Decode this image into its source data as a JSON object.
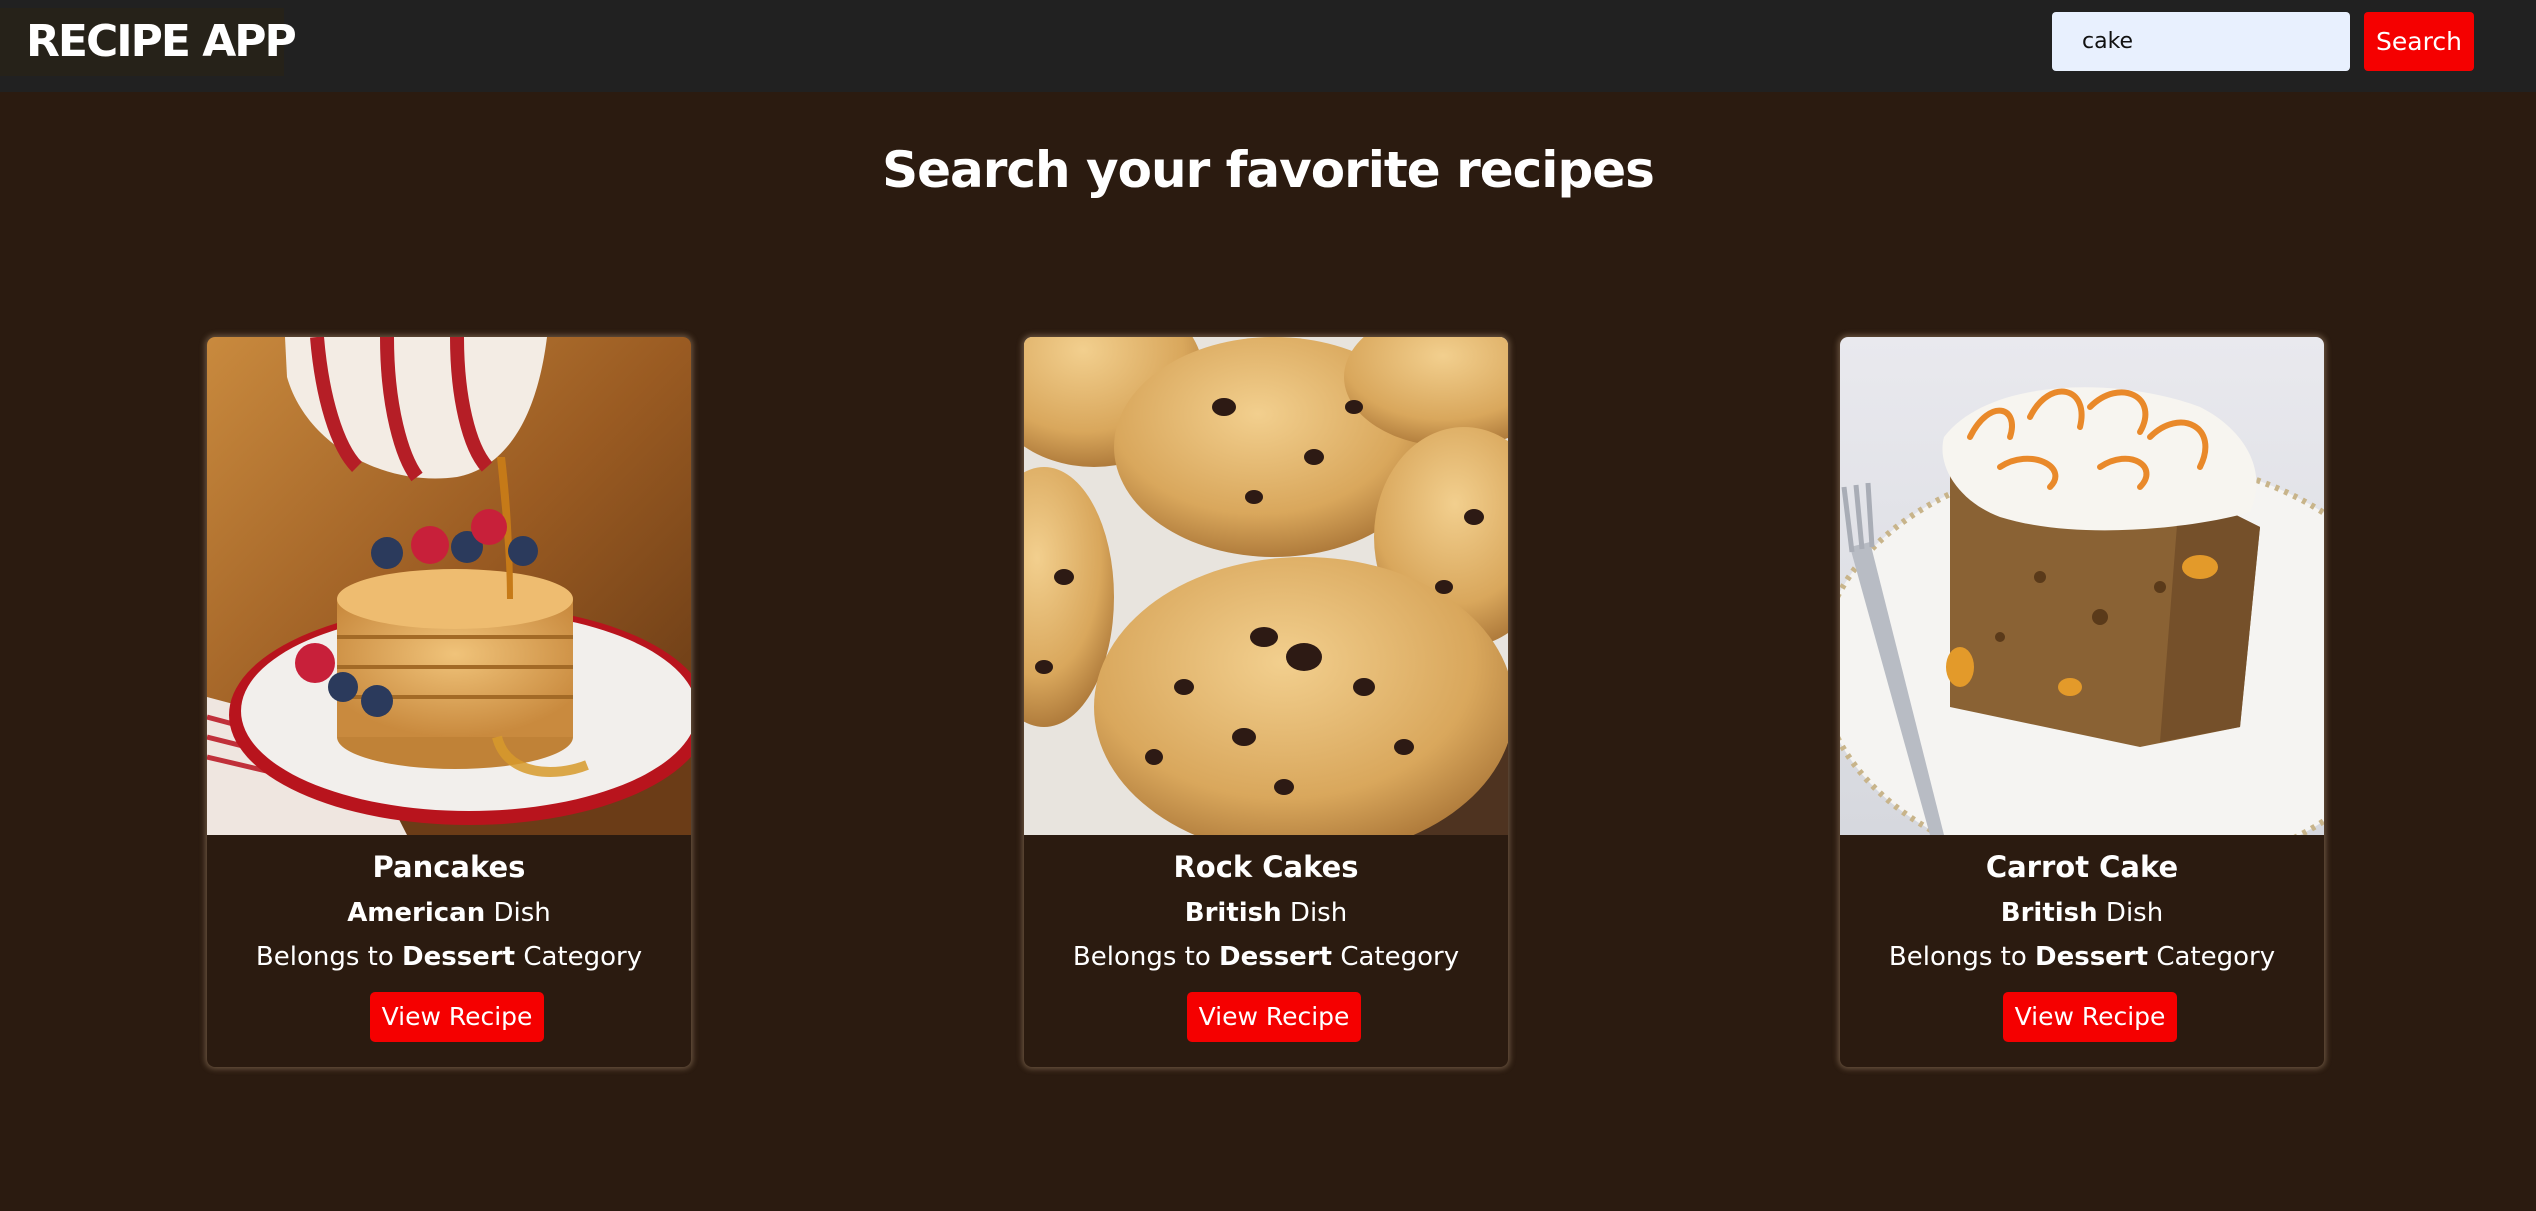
{
  "header": {
    "logo_text": "RECIPE APP",
    "search_value": "cake",
    "search_button_label": "Search"
  },
  "main": {
    "title": "Search your favorite recipes"
  },
  "recipes": [
    {
      "name": "Pancakes",
      "area": "American",
      "area_suffix": " Dish",
      "category_prefix": "Belongs to ",
      "category": "Dessert",
      "category_suffix": " Category",
      "button_label": "View Recipe",
      "image": "pancakes-photo"
    },
    {
      "name": "Rock Cakes",
      "area": "British",
      "area_suffix": " Dish",
      "category_prefix": "Belongs to ",
      "category": "Dessert",
      "category_suffix": " Category",
      "button_label": "View Recipe",
      "image": "rock-cakes-photo"
    },
    {
      "name": "Carrot Cake",
      "area": "British",
      "area_suffix": " Dish",
      "category_prefix": "Belongs to ",
      "category": "Dessert",
      "category_suffix": " Category",
      "button_label": "View Recipe",
      "image": "carrot-cake-photo"
    }
  ],
  "colors": {
    "background": "#2b1b10",
    "header": "#212121",
    "accent": "#f50000",
    "search_field": "#e8f0fe"
  }
}
